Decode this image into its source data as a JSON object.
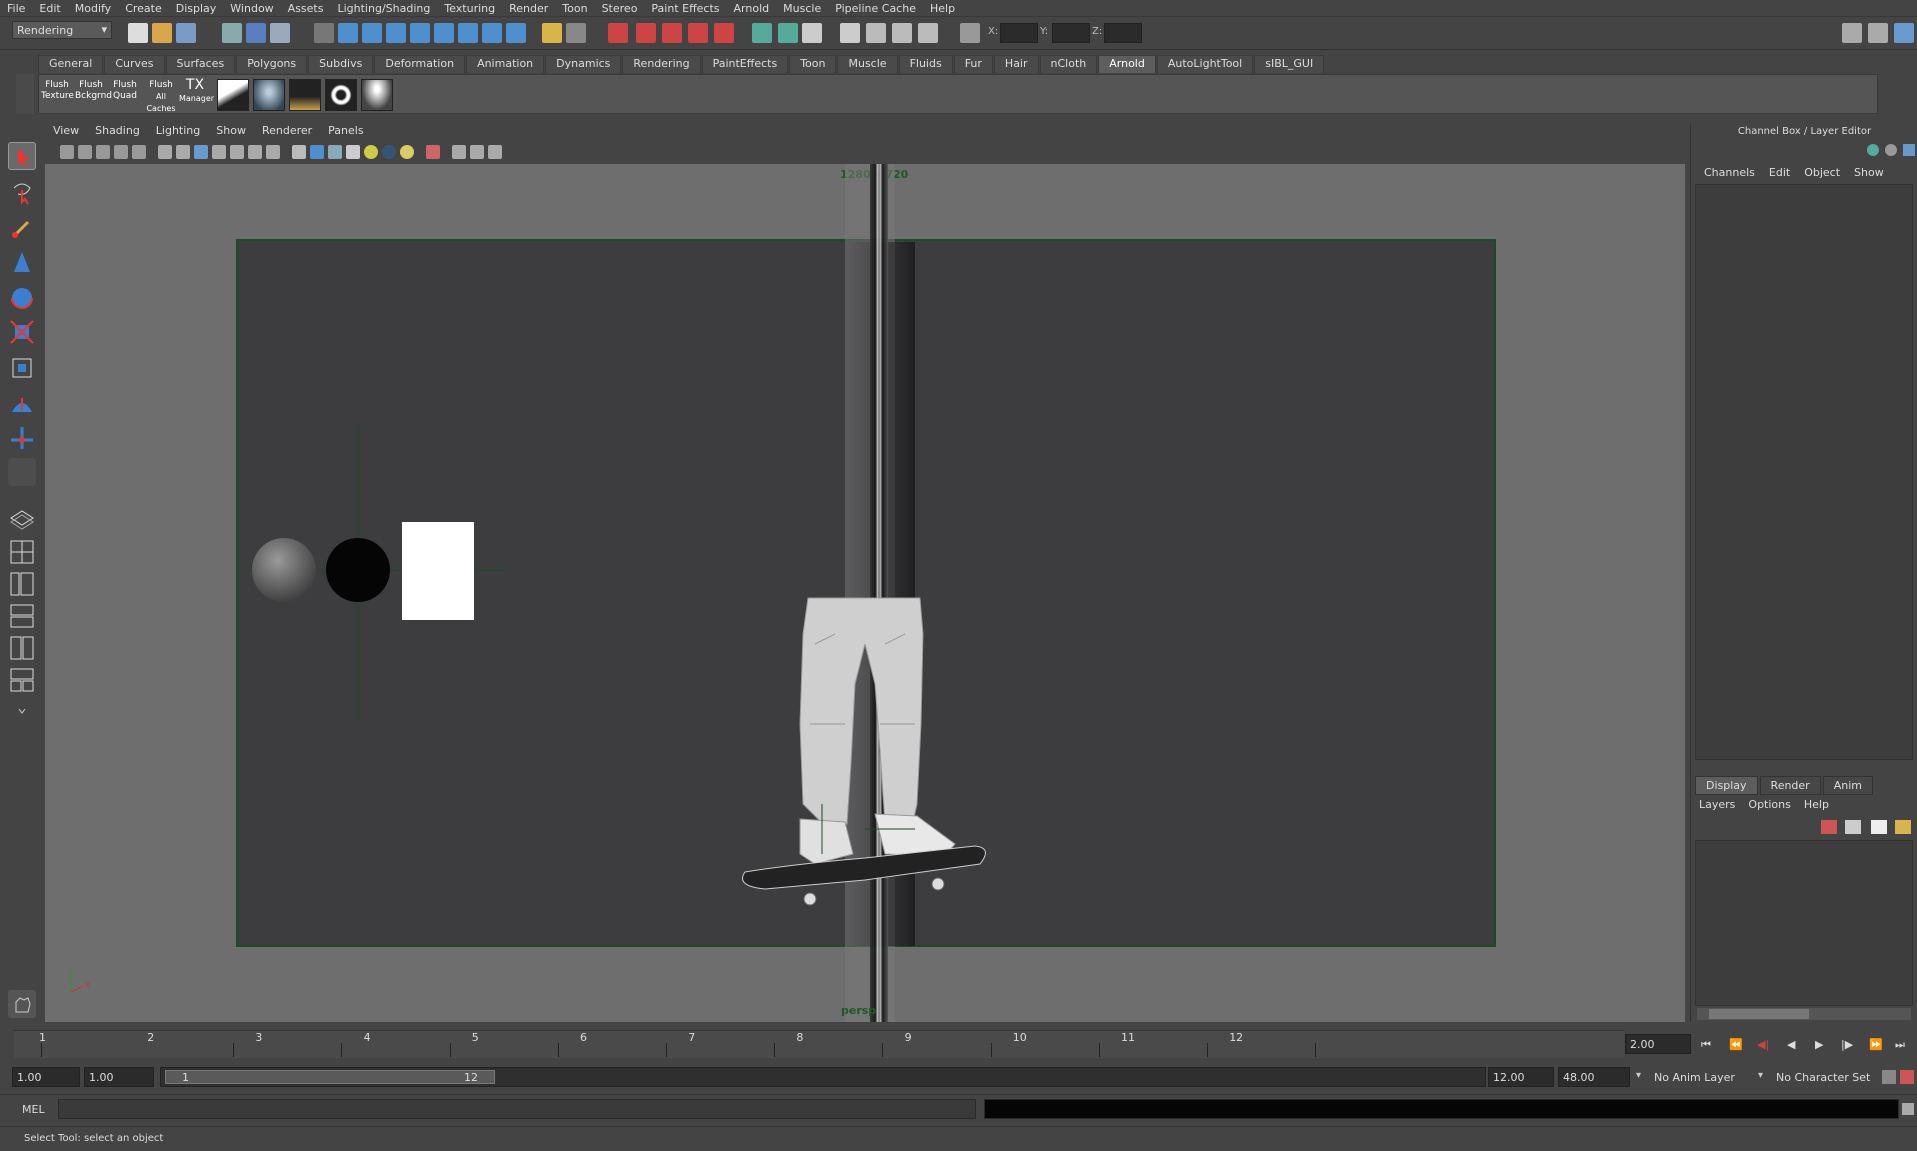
{
  "menubar": [
    "File",
    "Edit",
    "Modify",
    "Create",
    "Display",
    "Window",
    "Assets",
    "Lighting/Shading",
    "Texturing",
    "Render",
    "Toon",
    "Stereo",
    "Paint Effects",
    "Arnold",
    "Muscle",
    "Pipeline Cache",
    "Help"
  ],
  "status_line": {
    "menuset": "Rendering",
    "x_label": "X:",
    "y_label": "Y:",
    "z_label": "Z:"
  },
  "shelf_tabs": [
    "General",
    "Curves",
    "Surfaces",
    "Polygons",
    "Subdivs",
    "Deformation",
    "Animation",
    "Dynamics",
    "Rendering",
    "PaintEffects",
    "Toon",
    "Muscle",
    "Fluids",
    "Fur",
    "Hair",
    "nCloth",
    "Arnold",
    "AutoLightTool",
    "sIBL_GUI"
  ],
  "active_shelf_tab": "Arnold",
  "shelf_buttons": [
    {
      "l1": "Flush",
      "l2": "Texture"
    },
    {
      "l1": "Flush",
      "l2": "Bckgrnd"
    },
    {
      "l1": "Flush",
      "l2": "Quad"
    },
    {
      "l1": "Flush",
      "l2": "All Caches"
    },
    {
      "l1": "TX",
      "l2": "Manager"
    }
  ],
  "panel_menu": [
    "View",
    "Shading",
    "Lighting",
    "Show",
    "Renderer",
    "Panels"
  ],
  "viewport": {
    "resolution_label": "1280 x 720",
    "camera_label": "persp"
  },
  "channel_box": {
    "title": "Channel Box / Layer Editor",
    "menu": [
      "Channels",
      "Edit",
      "Object",
      "Show"
    ],
    "layer_tabs": [
      "Display",
      "Render",
      "Anim"
    ],
    "layer_menu": [
      "Layers",
      "Options",
      "Help"
    ]
  },
  "timeline": {
    "ticks": [
      "1",
      "2",
      "3",
      "4",
      "5",
      "6",
      "7",
      "8",
      "9",
      "10",
      "11",
      "12"
    ],
    "current_frame": "2.00"
  },
  "range": {
    "start_time": "1.00",
    "playback_start": "1.00",
    "slider_start": "1",
    "slider_end": "12",
    "playback_end": "12.00",
    "end_time": "48.00",
    "anim_layer": "No Anim Layer",
    "character_set": "No Character Set"
  },
  "command_line": {
    "language": "MEL"
  },
  "help_line": {
    "text": "Select Tool: select an object"
  },
  "colors": {
    "accent": "#5d5d5d",
    "resgate_border": "#1c4a24",
    "label_green": "#1d5a22"
  }
}
